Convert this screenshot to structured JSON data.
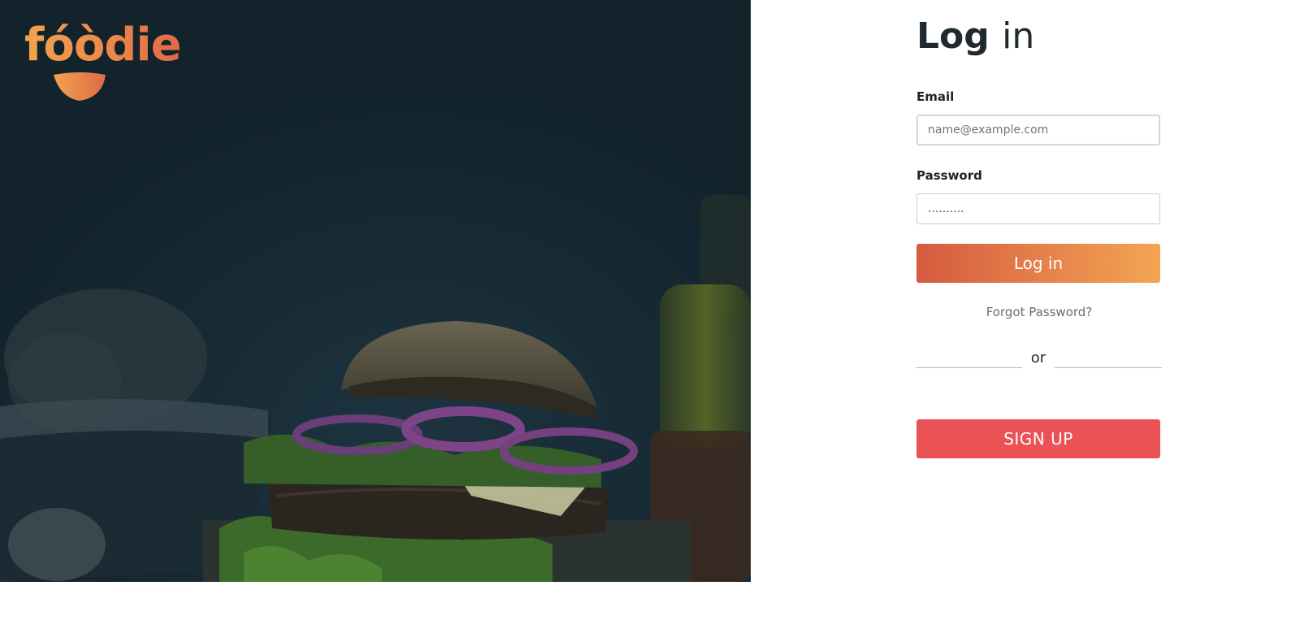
{
  "brand": {
    "logo_text": "fóòdie",
    "colors": {
      "gradient_start": "#f2a24f",
      "gradient_end": "#e06a45"
    }
  },
  "hero": {
    "image": "burger-photo",
    "overlay_color": "#12232c"
  },
  "login": {
    "title_bold": "Log",
    "title_light": "in",
    "email_label": "Email",
    "email_placeholder": "name@example.com",
    "password_label": "Password",
    "password_value": "..........",
    "submit_label": "Log in",
    "forgot_label": "Forgot Password?",
    "divider_text": "or",
    "signup_label": "SIGN UP"
  },
  "colors": {
    "login_gradient_start": "#d65a3f",
    "login_gradient_end": "#f3a553",
    "signup": "#ea5256",
    "heading": "#1e2a30"
  }
}
